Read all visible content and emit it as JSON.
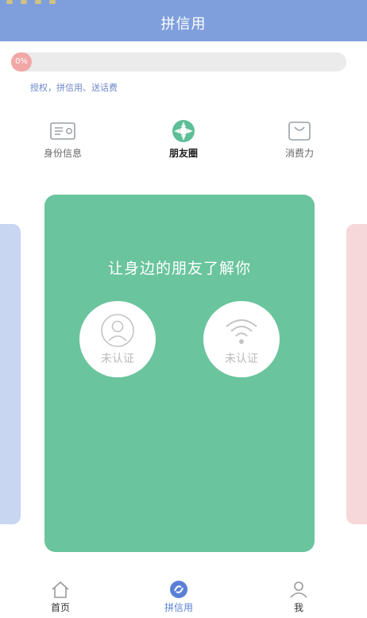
{
  "header": {
    "title": "拼信用"
  },
  "progress": {
    "percent_label": "0%",
    "tip": "授权，拼信用、送话费"
  },
  "steps": [
    {
      "label": "身份信息",
      "icon": "id-card-icon",
      "active": false
    },
    {
      "label": "朋友圈",
      "icon": "moments-camera-icon",
      "active": true
    },
    {
      "label": "消费力",
      "icon": "shopping-bag-icon",
      "active": false
    }
  ],
  "card": {
    "title": "让身边的朋友了解你",
    "auth_items": [
      {
        "status": "未认证",
        "icon": "user-icon"
      },
      {
        "status": "未认证",
        "icon": "wifi-icon"
      }
    ]
  },
  "nav": [
    {
      "label": "首页",
      "icon": "home-icon",
      "active": false
    },
    {
      "label": "拼信用",
      "icon": "credit-icon",
      "active": true
    },
    {
      "label": "我",
      "icon": "profile-icon",
      "active": false
    }
  ],
  "colors": {
    "header": "#7f9fdc",
    "card": "#6ac49d",
    "accent": "#5a7fd6"
  }
}
